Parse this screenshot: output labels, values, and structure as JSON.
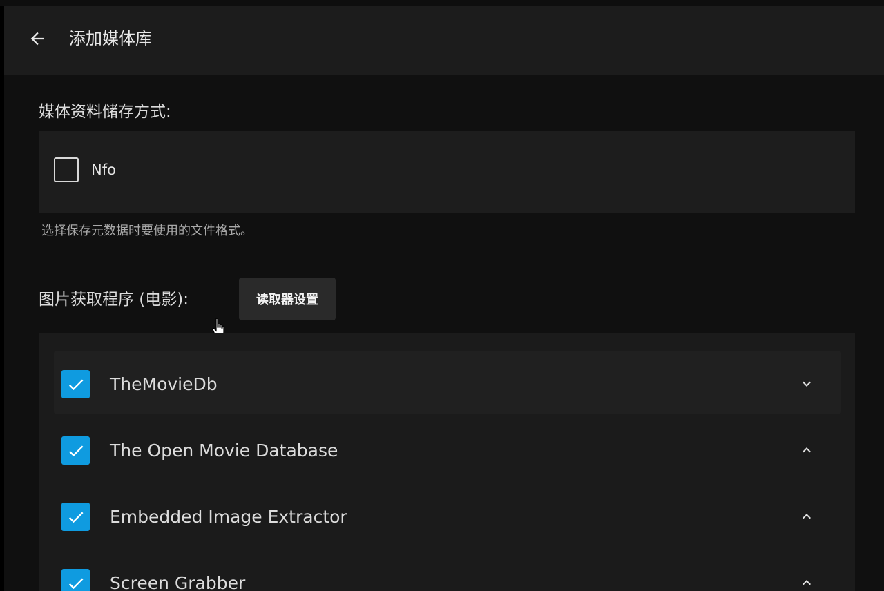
{
  "header": {
    "title": "添加媒体库",
    "back_icon": "arrow-left-icon"
  },
  "metadata_savers": {
    "label": "媒体资料储存方式:",
    "options": [
      {
        "label": "Nfo",
        "checked": false
      }
    ],
    "help_text": "选择保存元数据时要使用的文件格式。"
  },
  "image_fetchers": {
    "label": "图片获取程序 (电影):",
    "settings_button_label": "读取器设置",
    "items": [
      {
        "name": "TheMovieDb",
        "checked": true,
        "chevron": "chevron-down-icon"
      },
      {
        "name": "The Open Movie Database",
        "checked": true,
        "chevron": "chevron-up-icon"
      },
      {
        "name": "Embedded Image Extractor",
        "checked": true,
        "chevron": "chevron-up-icon"
      },
      {
        "name": "Screen Grabber",
        "checked": true,
        "chevron": "chevron-up-icon"
      }
    ]
  },
  "colors": {
    "accent": "#0f9be0",
    "background": "#101010",
    "header": "#1c1c1c",
    "panel": "#1b1b1b"
  }
}
